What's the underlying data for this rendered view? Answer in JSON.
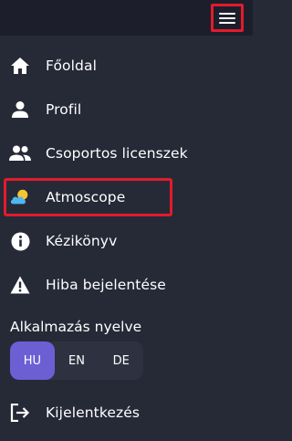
{
  "header": {
    "menu_icon": "hamburger-icon"
  },
  "nav": {
    "items": [
      {
        "label": "Főoldal",
        "icon": "home-icon"
      },
      {
        "label": "Profil",
        "icon": "user-icon"
      },
      {
        "label": "Csoportos licenszek",
        "icon": "group-icon"
      },
      {
        "label": "Atmoscope",
        "icon": "weather-icon"
      },
      {
        "label": "Kézikönyv",
        "icon": "info-icon"
      },
      {
        "label": "Hiba bejelentése",
        "icon": "warning-icon"
      }
    ]
  },
  "language": {
    "title": "Alkalmazás nyelve",
    "options": [
      "HU",
      "EN",
      "DE"
    ],
    "selected": "HU"
  },
  "logout": {
    "label": "Kijelentkezés",
    "icon": "logout-icon"
  },
  "colors": {
    "background": "#262a37",
    "topbar": "#1c1f2b",
    "accent": "#6c5fd4",
    "highlight": "#e21b2c"
  }
}
